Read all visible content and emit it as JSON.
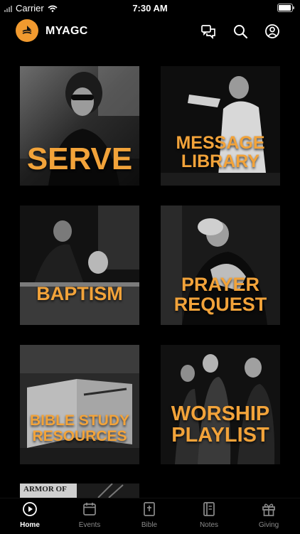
{
  "status_bar": {
    "carrier": "Carrier",
    "time": "7:30 AM"
  },
  "header": {
    "title": "MYAGC",
    "icons": [
      "chat-icon",
      "search-icon",
      "account-icon"
    ]
  },
  "tiles": [
    {
      "label": "SERVE"
    },
    {
      "label": "MESSAGE LIBRARY"
    },
    {
      "label": "BAPTISM"
    },
    {
      "label": "PRAYER REQUEST"
    },
    {
      "label": "BIBLE STUDY RESOURCES"
    },
    {
      "label": "WORSHIP PLAYLIST"
    },
    {
      "label": "ARMOR OF"
    }
  ],
  "tabbar": {
    "items": [
      {
        "label": "Home",
        "icon": "play-circle-icon",
        "active": true
      },
      {
        "label": "Events",
        "icon": "calendar-icon",
        "active": false
      },
      {
        "label": "Bible",
        "icon": "book-plus-icon",
        "active": false
      },
      {
        "label": "Notes",
        "icon": "notes-icon",
        "active": false
      },
      {
        "label": "Giving",
        "icon": "gift-icon",
        "active": false
      }
    ]
  },
  "colors": {
    "accent": "#f2a33a",
    "background": "#000000"
  }
}
